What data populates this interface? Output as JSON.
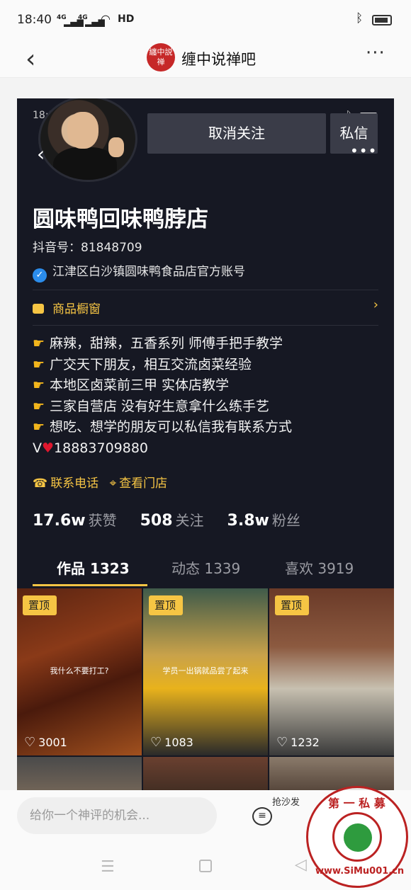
{
  "status": {
    "time": "18:40",
    "signal1": "4G",
    "signal2": "4G",
    "hd": "HD",
    "wifi_icon": "wifi-icon",
    "bluetooth_icon": "bluetooth-icon",
    "battery_icon": "battery-icon"
  },
  "nav": {
    "back_icon": "back-chevron-icon",
    "logo_text": "纏中説禅",
    "title": "缠中说禅吧",
    "more_icon": "more-dots-icon"
  },
  "profile": {
    "inner_time": "18:36",
    "unfollow_label": "取消关注",
    "message_label": "私信",
    "name": "圆味鸭回味鸭脖店",
    "douyin_id": "抖音号：81848709",
    "verified_text": "江津区白沙镇圆味鸭食品店官方账号",
    "shop_label": "商品橱窗",
    "bio": [
      "麻辣，甜辣，五香系列 师傅手把手教学",
      "广交天下朋友，相互交流卤菜经验",
      "本地区卤菜前三甲  实体店教学",
      "三家自营店 没有好生意拿什么练手艺",
      "想吃、想学的朋友可以私信我有联系方式"
    ],
    "bio_last_prefix": "V",
    "bio_last_number": "18883709880",
    "contact_phone": "联系电话",
    "contact_store": "查看门店",
    "stats": {
      "likes_num": "17.6w",
      "likes_label": "获赞",
      "following_num": "508",
      "following_label": "关注",
      "fans_num": "3.8w",
      "fans_label": "粉丝"
    },
    "tabs": [
      "作品 1323",
      "动态 1339",
      "喜欢 3919"
    ]
  },
  "videos": [
    {
      "pin": "置顶",
      "caption": "我什么不要打工?",
      "likes": "3001"
    },
    {
      "pin": "置顶",
      "caption": "学员一出锅就品尝了起来",
      "likes": "1083"
    },
    {
      "pin": "置顶",
      "caption": "",
      "likes": "1232"
    }
  ],
  "comment": {
    "placeholder": "给你一个神评的机会...",
    "sofa_label": "抢沙发"
  },
  "watermark": {
    "top_text": "第 一 私 募",
    "bottom_text": "www.SiMu001.cn"
  },
  "colors": {
    "accent_yellow": "#f6c544",
    "card_bg": "#161823",
    "verified_blue": "#2b8ceb",
    "heart_red": "#e0172e"
  }
}
